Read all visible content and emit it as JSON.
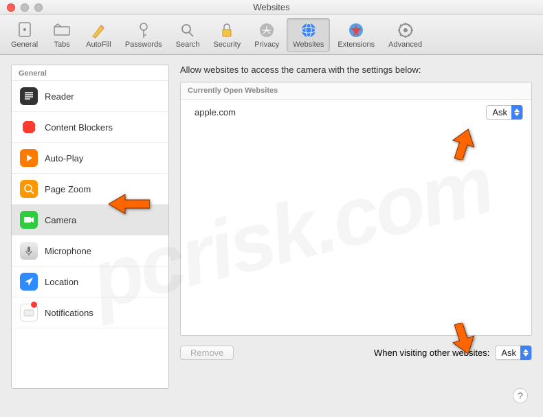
{
  "window": {
    "title": "Websites"
  },
  "toolbar": {
    "items": [
      {
        "label": "General"
      },
      {
        "label": "Tabs"
      },
      {
        "label": "AutoFill"
      },
      {
        "label": "Passwords"
      },
      {
        "label": "Search"
      },
      {
        "label": "Security"
      },
      {
        "label": "Privacy"
      },
      {
        "label": "Websites"
      },
      {
        "label": "Extensions"
      },
      {
        "label": "Advanced"
      }
    ]
  },
  "sidebar": {
    "header": "General",
    "items": [
      {
        "label": "Reader"
      },
      {
        "label": "Content Blockers"
      },
      {
        "label": "Auto-Play"
      },
      {
        "label": "Page Zoom"
      },
      {
        "label": "Camera"
      },
      {
        "label": "Microphone"
      },
      {
        "label": "Location"
      },
      {
        "label": "Notifications"
      }
    ]
  },
  "main": {
    "heading": "Allow websites to access the camera with the settings below:",
    "list_header": "Currently Open Websites",
    "sites": [
      {
        "name": "apple.com",
        "value": "Ask"
      }
    ],
    "remove_label": "Remove",
    "other_label": "When visiting other websites:",
    "other_value": "Ask"
  },
  "help": "?"
}
